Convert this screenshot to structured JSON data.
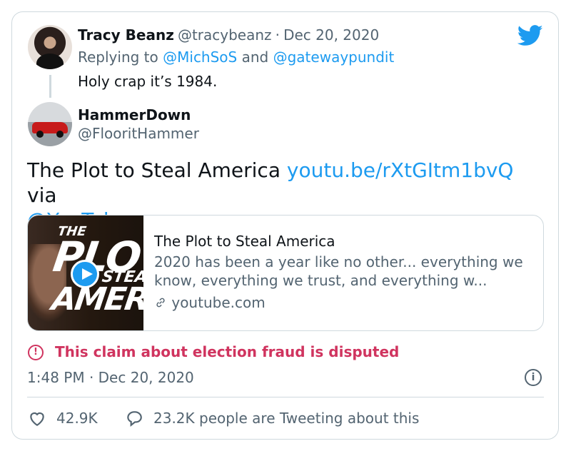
{
  "reply": {
    "name": "Tracy Beanz",
    "handle": "@tracybeanz",
    "dot": "·",
    "date": "Dec 20, 2020",
    "replying_prefix": "Replying to",
    "replying_user1": "@MichSoS",
    "replying_and": "and",
    "replying_user2": "@gatewaypundit",
    "text": "Holy crap it’s 1984."
  },
  "tweet": {
    "name": "HammerDown",
    "handle": "@FlooritHammer",
    "text_pre": "The Plot to Steal America",
    "link": "youtu.be/rXtGItm1bvQ",
    "via": "via",
    "mention": "@YouTube",
    "time": "1:48 PM · Dec 20, 2020",
    "likes": "42.9K",
    "tweeting": "23.2K people are Tweeting about this"
  },
  "link_card": {
    "title": "The Plot to Steal America",
    "description": "2020 has been a year like no other... everything we know, everything we trust, and everything w...",
    "domain": "youtube.com",
    "thumb_line1": "THE",
    "thumb_line2": "PLO",
    "thumb_line3": "STEAL",
    "thumb_line4": "AMERI"
  },
  "dispute": {
    "label": "This claim about election fraud is disputed",
    "color": "#d0345f"
  },
  "colors": {
    "link": "#1d9bf0",
    "muted": "#536471",
    "border": "#cfd9de"
  },
  "icons": [
    "twitter-bird-icon",
    "play-icon",
    "link-icon",
    "alert-circle-icon",
    "info-icon",
    "heart-icon",
    "reply-bubble-icon"
  ]
}
